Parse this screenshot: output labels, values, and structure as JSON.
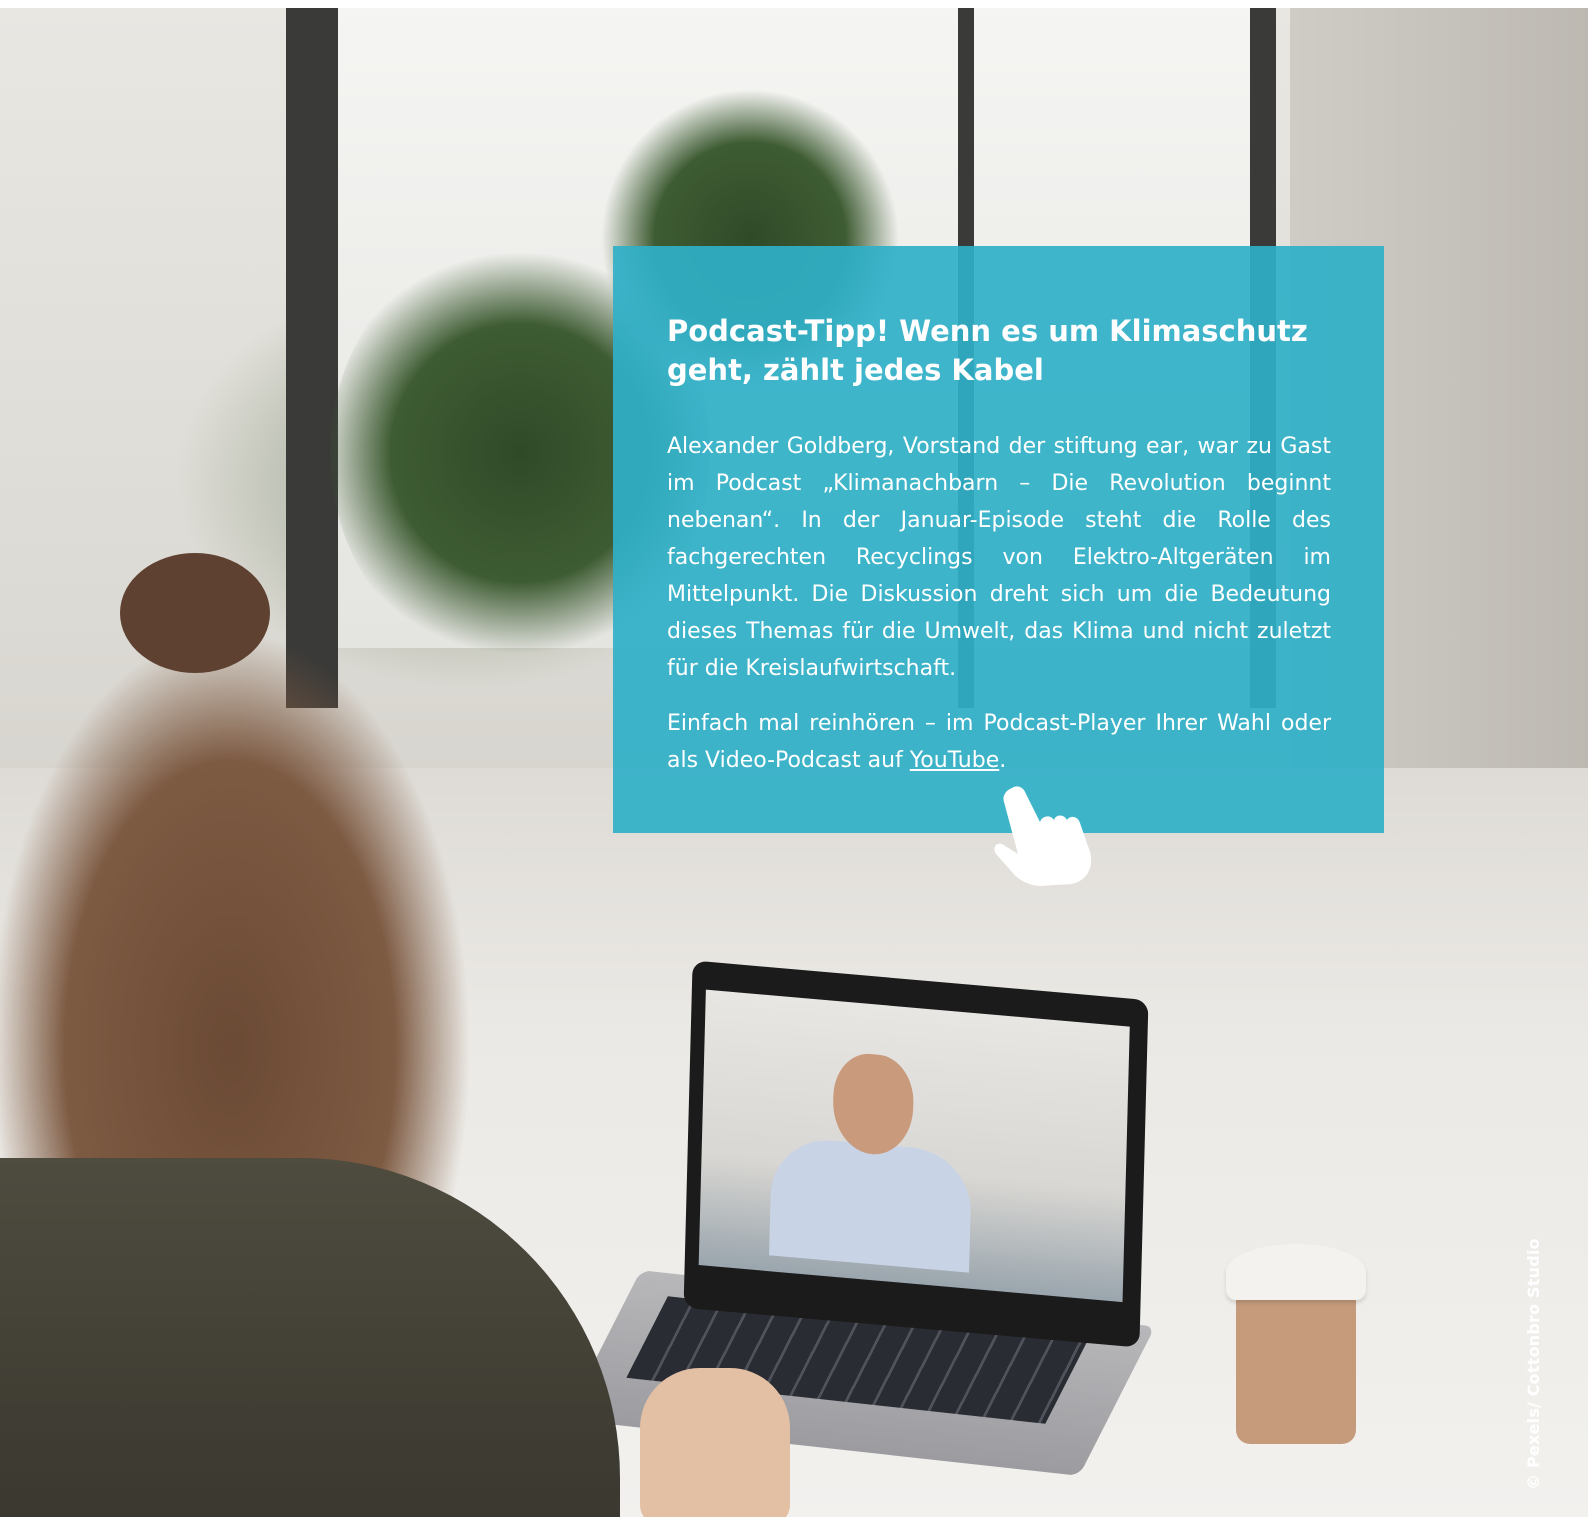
{
  "tip": {
    "title": "Podcast-Tipp! Wenn es um Klimaschutz geht, zählt jedes Kabel",
    "paragraph1": "Alexander Goldberg, Vorstand der stiftung ear, war zu Gast im Podcast „Klimanachbarn – Die Revolution beginnt nebenan“. In der Januar-Episode steht die Rolle des fachgerechten Recyclings von Elektro-Altgeräten im Mittelpunkt. Die Diskussion dreht sich um die Bedeutung dieses Themas für die Umwelt, das Klima und nicht zuletzt für die Kreislaufwirtschaft.",
    "paragraph2_before": "Einfach mal reinhören – im Podcast-Player Ihrer Wahl oder als Video-Podcast auf ",
    "link_label": "YouTube",
    "paragraph2_after": "."
  },
  "photo_credit": "© Pexels/ Cottonbro Studio",
  "colors": {
    "panel": "#30b0c8",
    "text": "#ffffff"
  },
  "icons": {
    "cursor": "pointing-hand-icon"
  }
}
